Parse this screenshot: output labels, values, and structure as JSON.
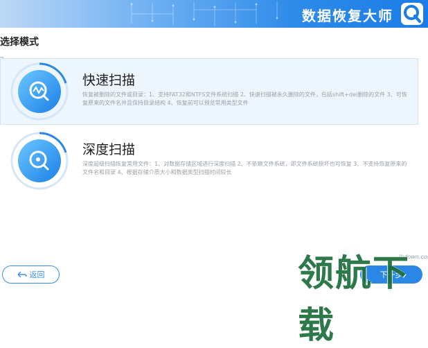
{
  "header": {
    "app_title": "数据恢复大师",
    "logo_icon": "magnifier-q-icon"
  },
  "page": {
    "section_title": "选择模式"
  },
  "modes": [
    {
      "title": "快速扫描",
      "description": "恢复被删除的文件或目录：1、支持FAT32和NTFS文件系统扫描 2、快速扫描被永久删除的文件，包括shift+del删除的文件 3、可恢复原来的文件名并且保持目录结构 4、恢复前可以预览常用类型文件",
      "icon": "pulse-magnifier-icon",
      "selected": true
    },
    {
      "title": "深度扫描",
      "description": "深度超级扫描恢复常用文件：1、对数据存储区域进行深度扫描 2、不依赖文件系统，即文件系统损坏也可恢复 3、不支持恢复原来的文件名和目录 4、根据存储介质大小和数据类型扫描时间较长",
      "icon": "disk-magnifier-icon",
      "selected": false
    }
  ],
  "footer": {
    "back_label": "返回",
    "next_label": "下一步"
  },
  "watermark": {
    "text": "领航下载",
    "url": "lhdown.com"
  },
  "colors": {
    "accent": "#2b87e6",
    "selected_bg": "#eef6fd",
    "watermark_green": "#1d6e3a"
  }
}
